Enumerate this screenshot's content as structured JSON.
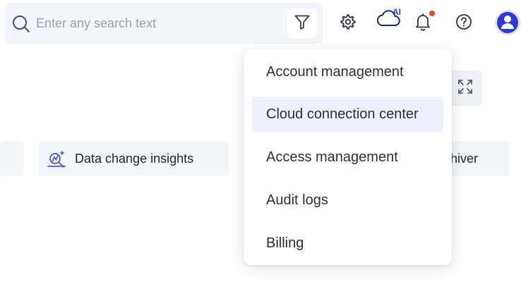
{
  "search": {
    "placeholder": "Enter any search text",
    "value": ""
  },
  "header": {
    "ai_badge": "AI",
    "notification_dot_color": "#e2452a",
    "accent_color": "#2f3ad6"
  },
  "icons": {
    "search": "search-icon",
    "filter": "filter-icon",
    "settings": "gear-icon",
    "cloud_ai": "cloud-ai-icon",
    "notifications": "bell-icon",
    "help": "help-icon",
    "avatar": "user-icon",
    "expand": "expand-icon",
    "data_insights": "data-insights-icon"
  },
  "cards": {
    "data_change_insights": "Data change insights",
    "partial_right": "hiver"
  },
  "dropdown": {
    "items": [
      {
        "label": "Account management",
        "active": false
      },
      {
        "label": "Cloud connection center",
        "active": true
      },
      {
        "label": "Access management",
        "active": false
      },
      {
        "label": "Audit logs",
        "active": false
      },
      {
        "label": "Billing",
        "active": false
      }
    ]
  }
}
